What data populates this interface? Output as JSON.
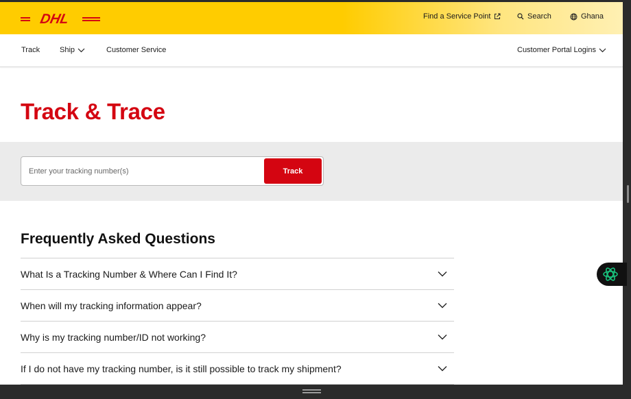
{
  "brand": {
    "logo_text": "DHL",
    "primary": "#d40511",
    "yellow": "#ffcc00"
  },
  "header": {
    "service_point_label": "Find a Service Point",
    "search_label": "Search",
    "country_label": "Ghana"
  },
  "nav": {
    "track_label": "Track",
    "ship_label": "Ship",
    "customer_service_label": "Customer Service",
    "portal_label": "Customer Portal Logins"
  },
  "page": {
    "title": "Track & Trace"
  },
  "search": {
    "placeholder": "Enter your tracking number(s)",
    "value": "",
    "button_label": "Track"
  },
  "faq": {
    "title": "Frequently Asked Questions",
    "items": [
      {
        "question": "What Is a Tracking Number & Where Can I Find It?"
      },
      {
        "question": "When will my tracking information appear?"
      },
      {
        "question": "Why is my tracking number/ID not working?"
      },
      {
        "question": "If I do not have my tracking number, is it still possible to track my shipment?"
      }
    ]
  },
  "icons": {
    "external_link": "external-link-icon",
    "search": "search-icon",
    "globe": "globe-icon",
    "chevron": "chevron-down-icon",
    "assistant": "assistant-icon"
  }
}
